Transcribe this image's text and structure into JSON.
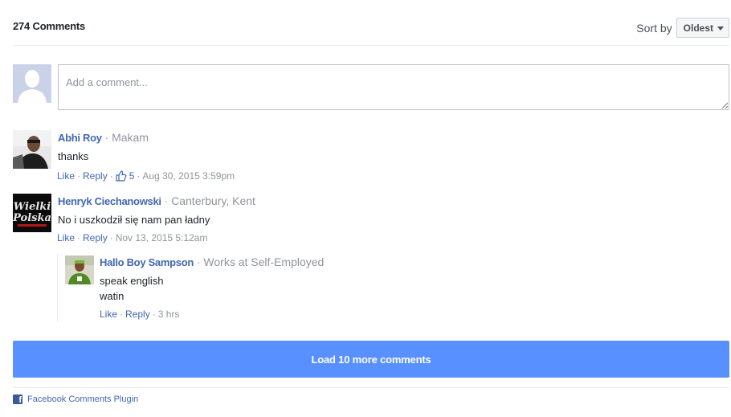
{
  "header": {
    "count": "274 Comments",
    "sort_label": "Sort by",
    "sort_value": "Oldest"
  },
  "composer": {
    "placeholder": "Add a comment..."
  },
  "comments": [
    {
      "name": "Abhi Roy",
      "meta": " · Makam",
      "text": "thanks",
      "like": "Like",
      "reply": "Reply",
      "likes": "5",
      "time": "Aug 30, 2015 3:59pm"
    },
    {
      "name": "Henryk Ciechanowski",
      "meta": " · Canterbury, Kent",
      "text": "No i uszkodził się nam pan ładny",
      "like": "Like",
      "reply": "Reply",
      "time": "Nov 13, 2015 5:12am",
      "avatar_text": [
        "Wielki",
        "Polska"
      ]
    }
  ],
  "reply": {
    "name": "Hallo Boy Sampson",
    "meta": " · Works at Self-Employed",
    "lines": [
      "speak english",
      "watin"
    ],
    "like": "Like",
    "reply": "Reply",
    "time": "3 hrs"
  },
  "load_more": "Load 10 more comments",
  "footer": {
    "text": "Facebook Comments Plugin"
  },
  "colors": {
    "link": "#4267b2",
    "button": "#5890ff",
    "muted": "#90949c"
  }
}
